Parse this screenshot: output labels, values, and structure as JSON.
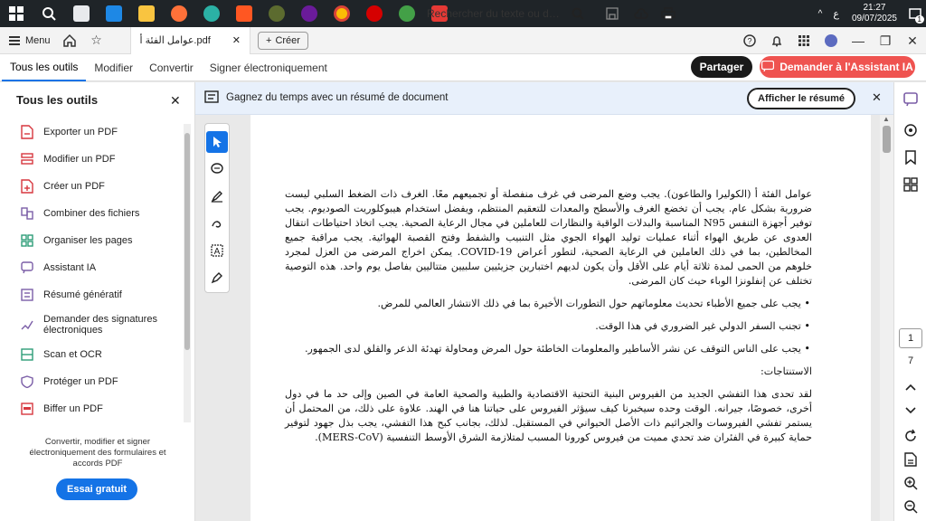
{
  "taskbar": {
    "lang": "ع",
    "time": "21:27",
    "date": "09/07/2025",
    "notif_count": "1"
  },
  "tabbar": {
    "menu_label": "Menu",
    "doc_tab_title": "عوامل الفئة أ.pdf",
    "new_label": "Créer"
  },
  "toolbar": {
    "tabs": [
      "Tous les outils",
      "Modifier",
      "Convertir",
      "Signer électroniquement"
    ],
    "search_text": "Rechercher du texte ou des o...",
    "share_label": "Partager",
    "ai_label": "Demander à l'Assistant IA"
  },
  "leftpanel": {
    "title": "Tous les outils",
    "items": [
      {
        "label": "Exporter un PDF",
        "color": "#d7373f"
      },
      {
        "label": "Modifier un PDF",
        "color": "#d7373f"
      },
      {
        "label": "Créer un PDF",
        "color": "#d7373f"
      },
      {
        "label": "Combiner des fichiers",
        "color": "#7b5ea7"
      },
      {
        "label": "Organiser les pages",
        "color": "#2d9d78"
      },
      {
        "label": "Assistant IA",
        "color": "#7b5ea7"
      },
      {
        "label": "Résumé génératif",
        "color": "#7b5ea7"
      },
      {
        "label": "Demander des signatures électroniques",
        "color": "#7b5ea7"
      },
      {
        "label": "Scan et OCR",
        "color": "#2d9d78"
      },
      {
        "label": "Protéger un PDF",
        "color": "#7b5ea7"
      },
      {
        "label": "Biffer un PDF",
        "color": "#d7373f"
      }
    ],
    "promo_text": "Convertir, modifier et signer électroniquement des formulaires et accords PDF",
    "trial_label": "Essai gratuit"
  },
  "banner": {
    "text": "Gagnez du temps avec un résumé de document",
    "button_label": "Afficher le résumé"
  },
  "document": {
    "paragraph1": "عوامل الفئة أ (الكوليرا والطاعون). يجب وضع المرضى في غرف منفصلة أو تجميعهم معًا. الغرف ذات الضغط السلبي ليست ضرورية بشكل عام. يجب أن تخضع الغرف والأسطح والمعدات للتعقيم المنتظم، ويفضل استخدام هيبوكلوريت الصوديوم. يجب توفير أجهزة التنفس N95 المناسبة والبدلات الواقية والنظارات للعاملين في مجال الرعاية الصحية. يجب اتخاذ احتياطات انتقال العدوى عن طريق الهواء أثناء عمليات توليد الهواء الجوي مثل التنبيب والشفط وفتح القصبة الهوائية. يجب مراقبة جميع المخالطين، بما في ذلك العاملين في الرعاية الصحية، لتطور أعراض COVID-19. يمكن اخراج المرضى من العزل لمجرد خلوهم من الحمى لمدة ثلاثة أيام على الأقل وأن يكون لديهم اختبارين جزيئيين سلبيين متتاليين بفاصل يوم واحد. هذه التوصية تختلف عن إنفلونزا الوباء حيث كان المرضى.",
    "bullets": [
      "• يجب على جميع الأطباء تحديث معلوماتهم حول التطورات الأخيرة بما في ذلك الانتشار العالمي للمرض.",
      "• تجنب السفر الدولي غير الضروري في هذا الوقت.",
      "• يجب على الناس التوقف عن نشر الأساطير والمعلومات الخاطئة حول المرض ومحاولة تهدئة الذعر والقلق لدى الجمهور."
    ],
    "conclusions_heading": "الاستنتاجات:",
    "paragraph2": "لقد تحدى هذا التفشي الجديد من الفيروس البنية التحتية الاقتصادية والطبية والصحية العامة في الصين وإلى حد ما في دول أخرى، خصوصًا، جيرانه. الوقت وحده سيخبرنا كيف سيؤثر الفيروس على حياتنا هنا في الهند. علاوة على ذلك، من المحتمل أن يستمر تفشي الفيروسات والجراثيم ذات الأصل الحيواني في المستقبل. لذلك، بجانب كبح هذا التفشي، يجب بذل جهود لتوفير حماية كبيرة في الفئران ضد تحدي مميت من فيروس كورونا المسبب لمتلازمة الشرق الأوسط التنفسية (MERS-CoV)."
  },
  "rightrail": {
    "current_page": "1",
    "total_pages": "7"
  }
}
